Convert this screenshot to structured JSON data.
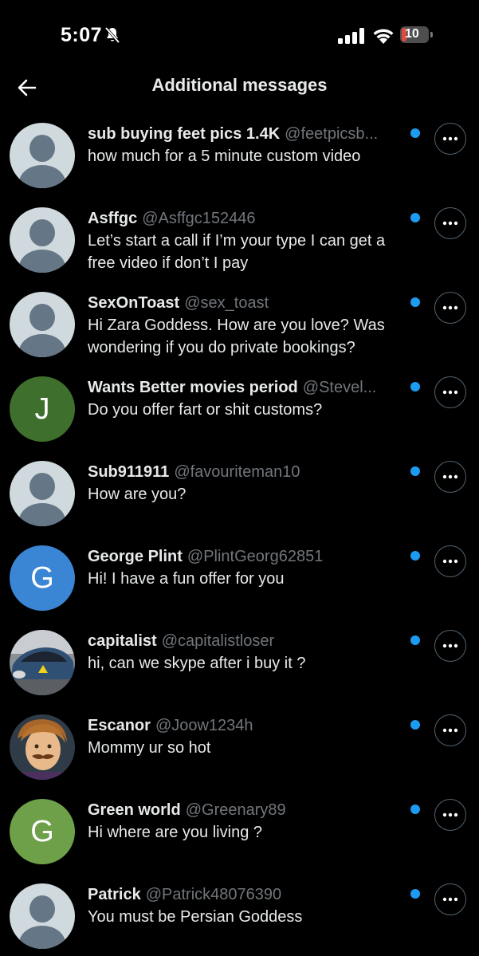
{
  "status_bar": {
    "time": "5:07",
    "battery": "10"
  },
  "header": {
    "title": "Additional messages"
  },
  "conversations": [
    {
      "name": "sub buying feet pics 1.4K",
      "handle": "@feetpicsb...",
      "message": "how much for a 5 minute custom video",
      "avatar": "default"
    },
    {
      "name": "Asffgc",
      "handle": "@Asffgc152446",
      "message": "Let’s start a call if I’m your type I can get a free video if don’t I pay",
      "avatar": "default"
    },
    {
      "name": "SexOnToast",
      "handle": "@sex_toast",
      "message": "Hi Zara Goddess.  How are you love? Was wondering if you do private bookings?",
      "avatar": "default"
    },
    {
      "name": "Wants Better movies period",
      "handle": "@Stevel...",
      "message": "Do you offer fart or shit customs?",
      "avatar": "letter",
      "letter": "J",
      "color": "#3f6f2c"
    },
    {
      "name": "Sub911911",
      "handle": "@favouriteman10",
      "message": "How are you?",
      "avatar": "default"
    },
    {
      "name": "George Plint",
      "handle": "@PlintGeorg62851",
      "message": "Hi! I have a fun offer for you",
      "avatar": "letter",
      "letter": "G",
      "color": "#3a86d4"
    },
    {
      "name": "capitalist",
      "handle": "@capitalistloser",
      "message": "hi, can we skype after i buy it ?",
      "avatar": "photo-car"
    },
    {
      "name": "Escanor",
      "handle": "@Joow1234h",
      "message": "Mommy ur so hot",
      "avatar": "photo-anime"
    },
    {
      "name": "Green world",
      "handle": "@Greenary89",
      "message": "Hi where are you living ?",
      "avatar": "letter",
      "letter": "G",
      "color": "#6ea04a"
    },
    {
      "name": "Patrick",
      "handle": "@Patrick48076390",
      "message": "You must be Persian Goddess",
      "avatar": "default"
    }
  ],
  "colors": {
    "unread_dot": "#1d9bf0",
    "handle": "#71767b",
    "background": "#000000"
  }
}
